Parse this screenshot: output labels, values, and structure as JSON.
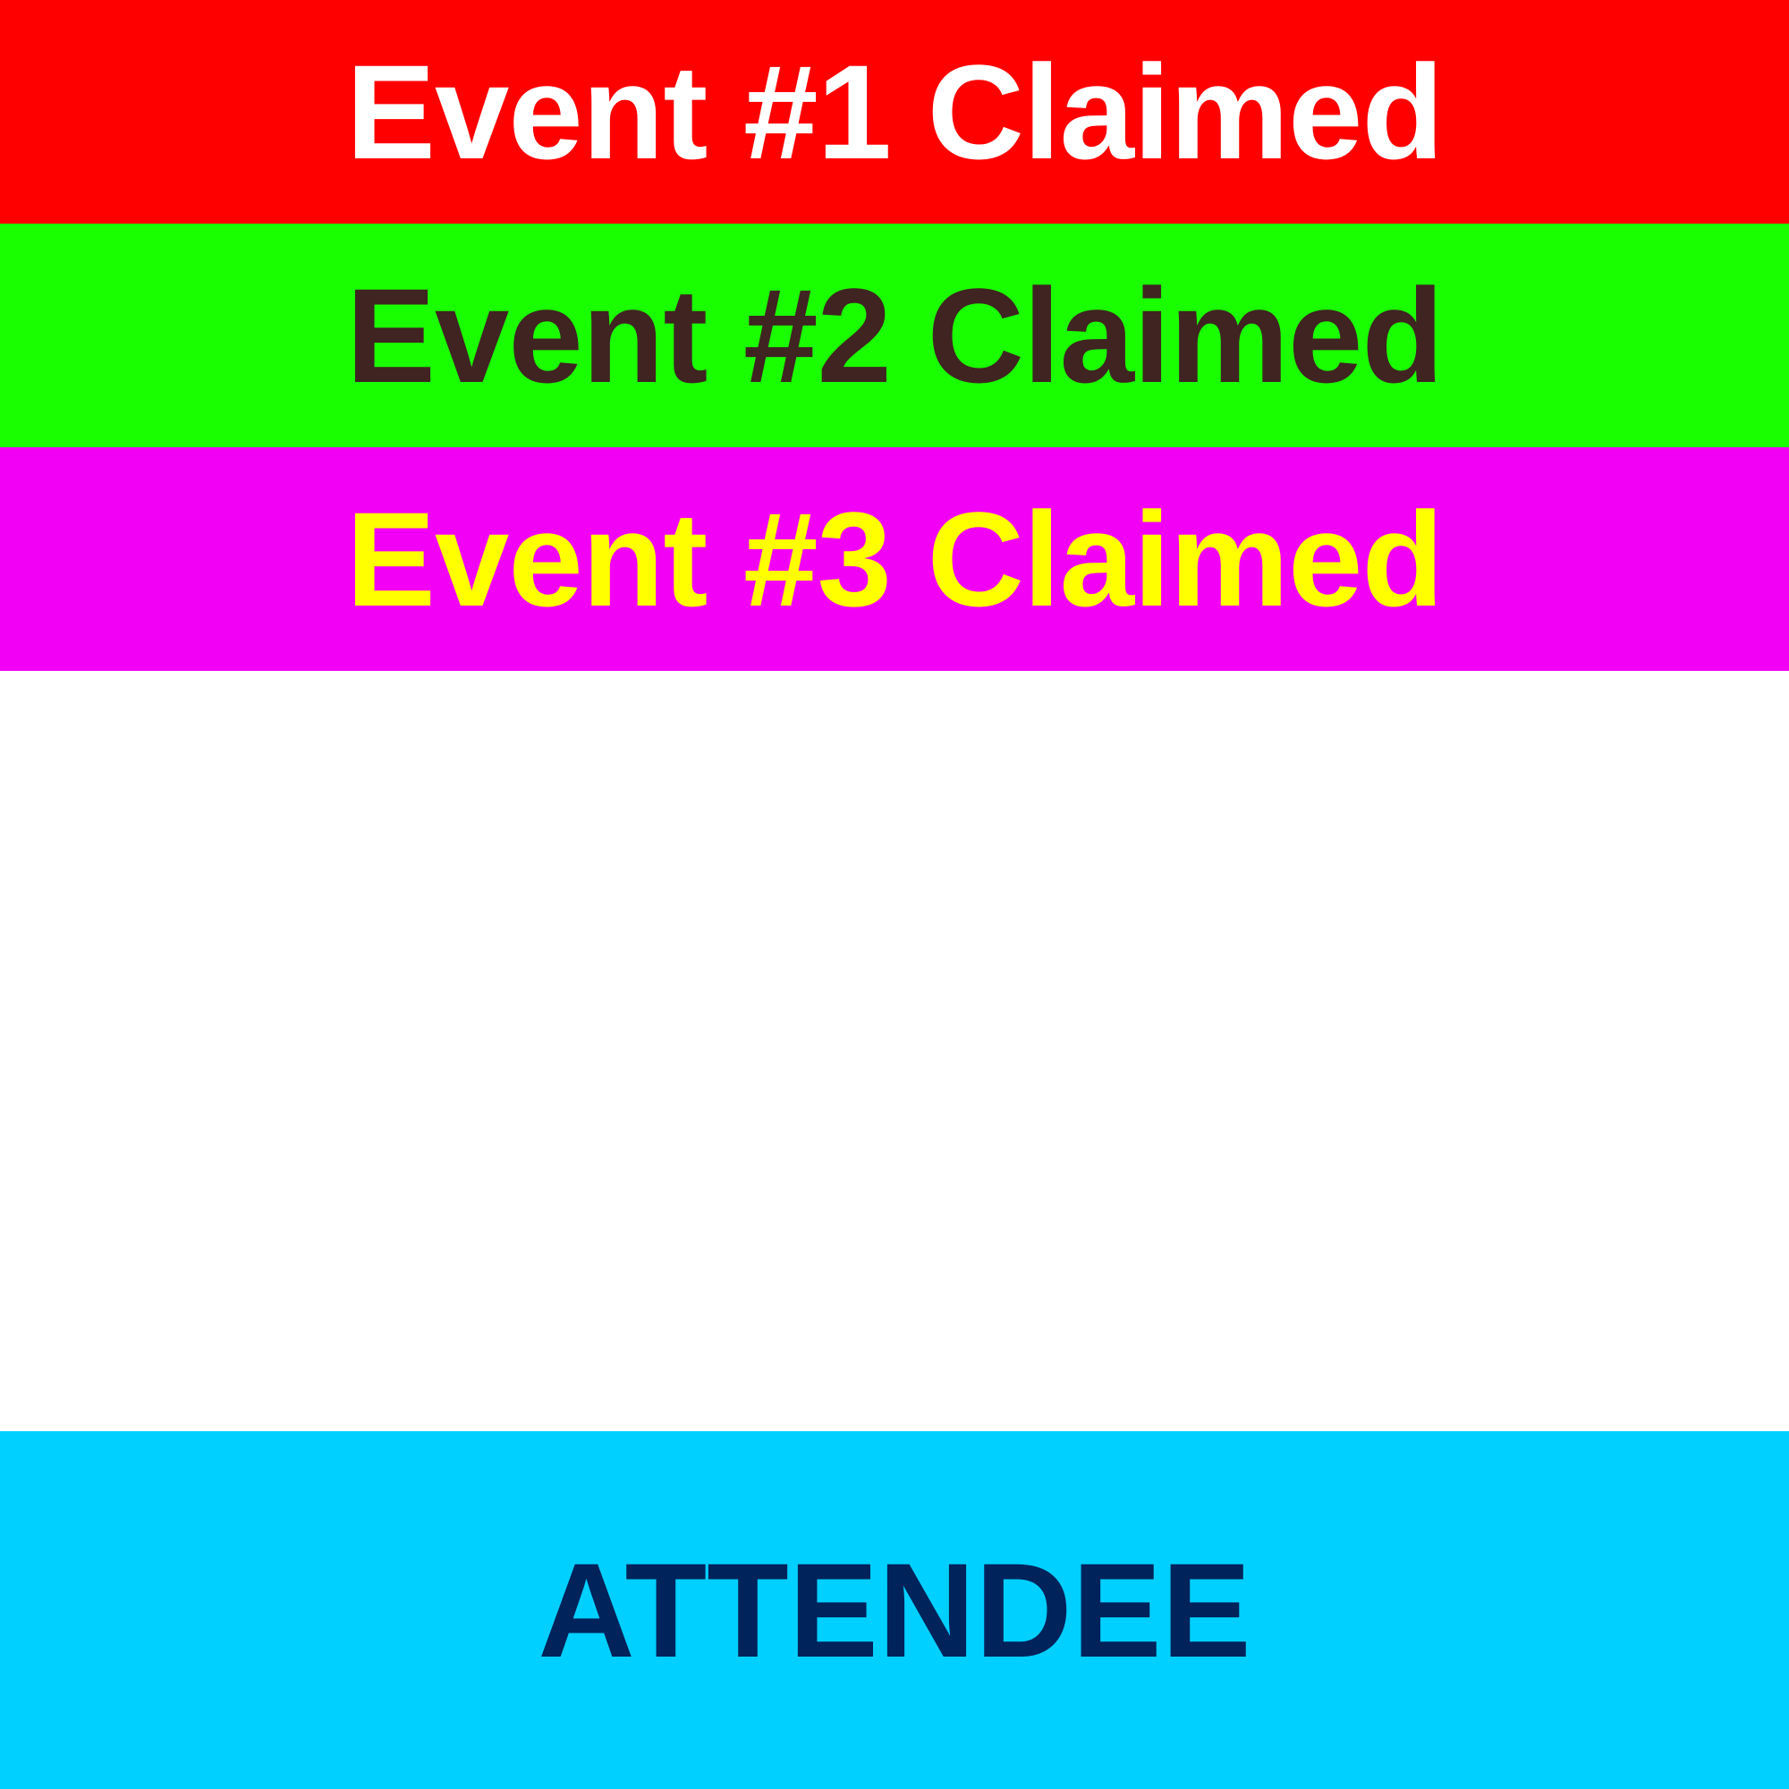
{
  "events": [
    {
      "label": "Event #1  Claimed",
      "background": "#ff0000",
      "text_color": "#ffffff"
    },
    {
      "label": "Event #2 Claimed",
      "background": "#19ff00",
      "text_color": "#3f2421"
    },
    {
      "label": "Event #3 Claimed",
      "background": "#f200f5",
      "text_color": "#ffff00"
    }
  ],
  "footer": {
    "label": "ATTENDEE",
    "background": "#00d0ff",
    "text_color": "#00235c"
  }
}
